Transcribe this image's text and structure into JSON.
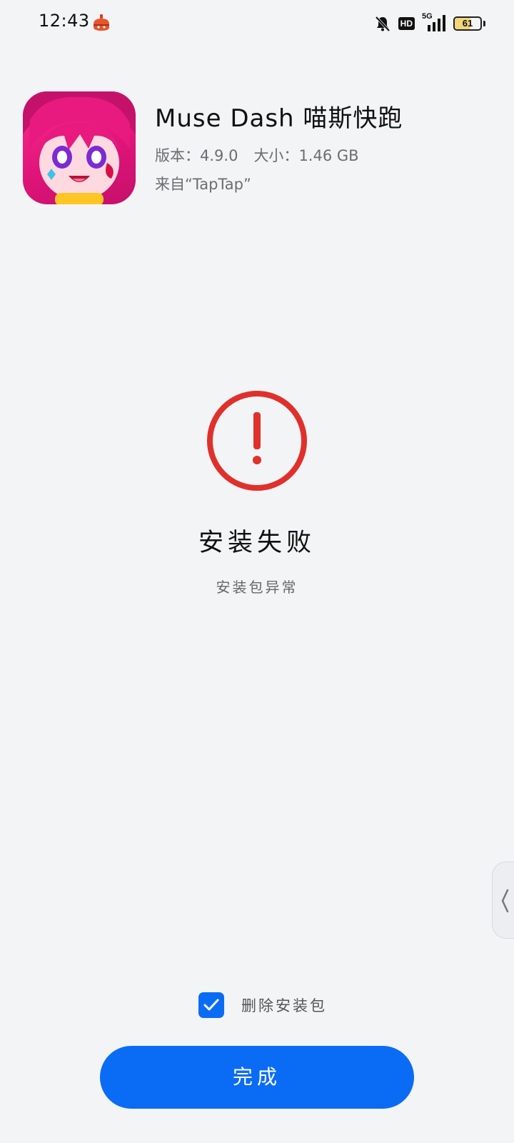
{
  "status_bar": {
    "time": "12:43",
    "network": "5G",
    "hd_label": "HD",
    "battery_level": "61"
  },
  "app": {
    "name": "Muse Dash 喵斯快跑",
    "version_label": "版本：",
    "version_value": "4.9.0",
    "size_label": "大小：",
    "size_value": "1.46 GB",
    "source": "来自“TapTap”"
  },
  "result": {
    "title": "安装失败",
    "reason": "安装包异常"
  },
  "options": {
    "delete_package_label": "删除安装包",
    "delete_package_checked": true
  },
  "actions": {
    "done_label": "完成"
  },
  "colors": {
    "accent": "#0a6cf5",
    "error": "#e0302b",
    "background": "#f3f4f6"
  }
}
